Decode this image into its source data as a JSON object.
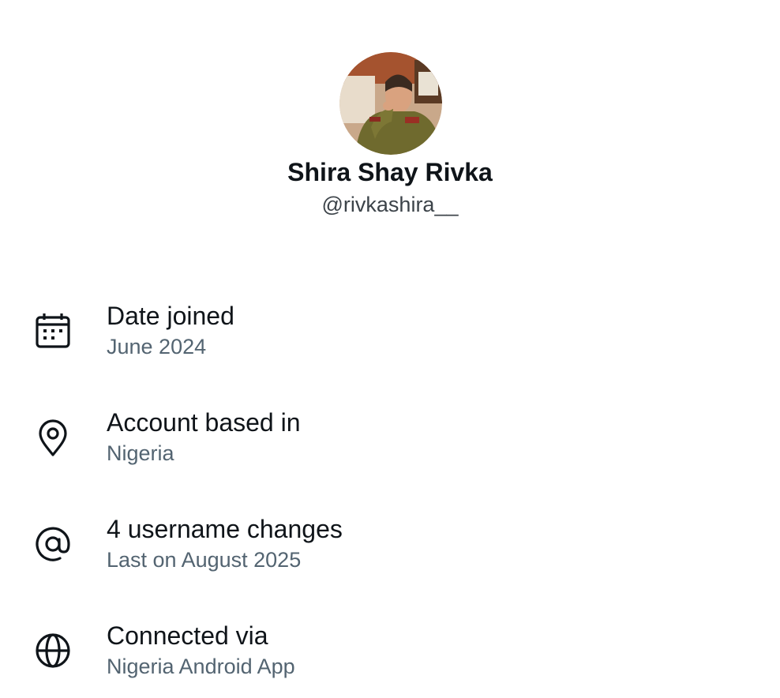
{
  "profile": {
    "display_name": "Shira Shay Rivka",
    "handle": "@rivkashira__"
  },
  "info": [
    {
      "icon": "calendar-icon",
      "title": "Date joined",
      "subtitle": "June 2024"
    },
    {
      "icon": "location-pin-icon",
      "title": "Account based in",
      "subtitle": "Nigeria"
    },
    {
      "icon": "at-sign-icon",
      "title": "4 username changes",
      "subtitle": "Last on August 2025"
    },
    {
      "icon": "globe-icon",
      "title": "Connected via",
      "subtitle": "Nigeria Android App"
    }
  ],
  "colors": {
    "text_primary": "#0f1419",
    "text_secondary": "#536471",
    "background": "#ffffff"
  }
}
